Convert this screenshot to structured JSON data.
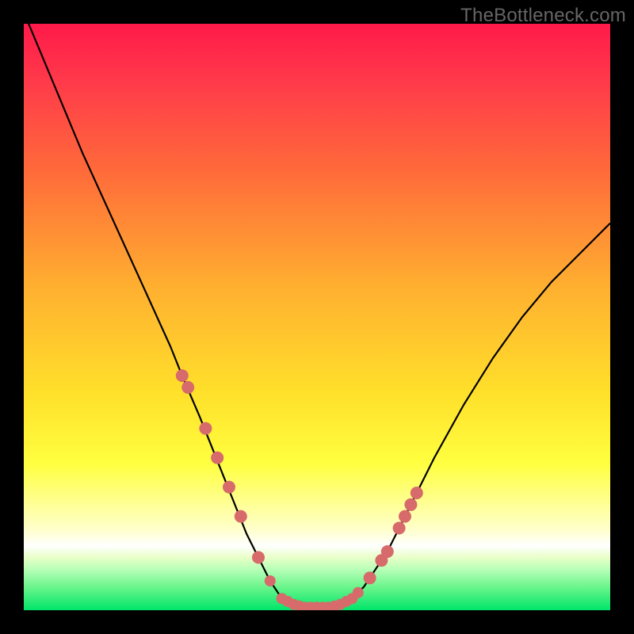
{
  "watermark": "TheBottleneck.com",
  "colors": {
    "frame": "#000000",
    "curve": "#000000",
    "marker": "#d76a6a",
    "gradient_stops": [
      "#ff1a4a",
      "#ff3a4a",
      "#ff6a3a",
      "#ffb030",
      "#ffe02a",
      "#ffff40",
      "#ffffc8",
      "#ffffff",
      "#e8ffc8",
      "#b8ffb8",
      "#6cf58c",
      "#00e56a"
    ]
  },
  "chart_data": {
    "type": "line",
    "title": "",
    "xlabel": "",
    "ylabel": "",
    "xlim": [
      0,
      100
    ],
    "ylim": [
      0,
      100
    ],
    "grid": false,
    "legend": false,
    "x": [
      0,
      5,
      10,
      15,
      20,
      25,
      27,
      30,
      32,
      34,
      36,
      38,
      40,
      42,
      44,
      46,
      48,
      50,
      52,
      54,
      56,
      58,
      60,
      62,
      64,
      66,
      70,
      75,
      80,
      85,
      90,
      95,
      100
    ],
    "y": [
      102,
      90,
      78,
      67,
      56,
      45,
      40,
      33,
      28,
      23,
      18,
      13,
      9,
      5,
      2,
      1,
      0.5,
      0.5,
      0.5,
      1,
      2,
      4,
      7,
      10,
      14,
      18,
      26,
      35,
      43,
      50,
      56,
      61,
      66
    ],
    "markers": {
      "left_branch": [
        {
          "x": 27,
          "y": 40
        },
        {
          "x": 28,
          "y": 38
        },
        {
          "x": 31,
          "y": 31
        },
        {
          "x": 33,
          "y": 26
        },
        {
          "x": 35,
          "y": 21
        },
        {
          "x": 37,
          "y": 16
        },
        {
          "x": 40,
          "y": 9
        }
      ],
      "trough": [
        {
          "x": 42,
          "y": 5
        },
        {
          "x": 44,
          "y": 2
        },
        {
          "x": 45,
          "y": 1.5
        },
        {
          "x": 46,
          "y": 1
        },
        {
          "x": 47,
          "y": 0.7
        },
        {
          "x": 48,
          "y": 0.5
        },
        {
          "x": 49,
          "y": 0.5
        },
        {
          "x": 50,
          "y": 0.5
        },
        {
          "x": 51,
          "y": 0.5
        },
        {
          "x": 52,
          "y": 0.5
        },
        {
          "x": 53,
          "y": 0.7
        },
        {
          "x": 54,
          "y": 1
        },
        {
          "x": 55,
          "y": 1.5
        },
        {
          "x": 56,
          "y": 2
        },
        {
          "x": 57,
          "y": 3
        }
      ],
      "right_branch": [
        {
          "x": 59,
          "y": 5.5
        },
        {
          "x": 61,
          "y": 8.5
        },
        {
          "x": 62,
          "y": 10
        },
        {
          "x": 64,
          "y": 14
        },
        {
          "x": 65,
          "y": 16
        },
        {
          "x": 66,
          "y": 18
        },
        {
          "x": 67,
          "y": 20
        }
      ]
    }
  }
}
